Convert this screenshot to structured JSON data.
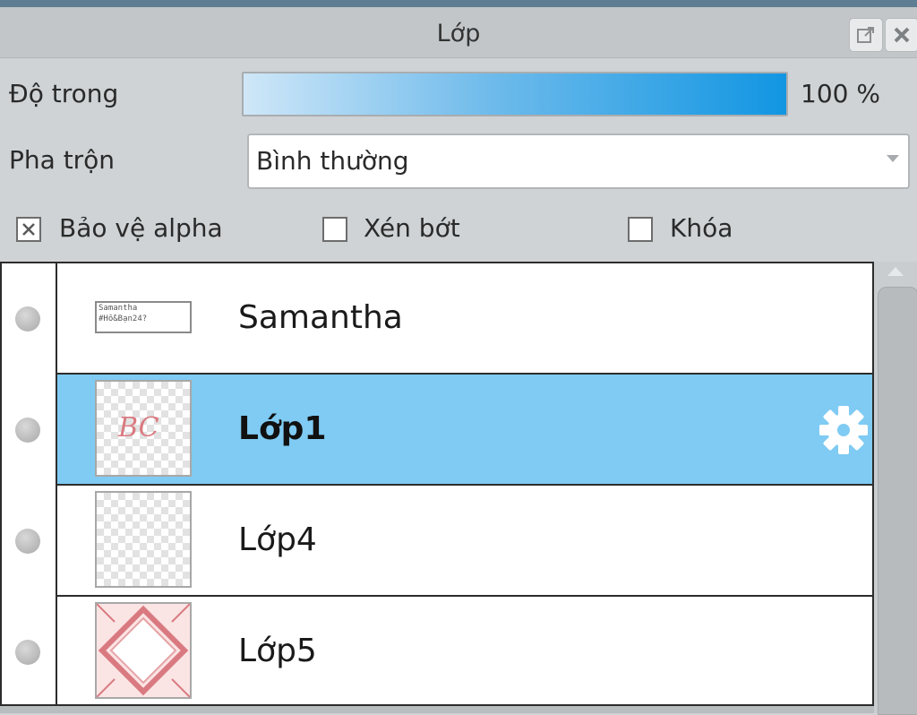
{
  "panel": {
    "title": "Lớp"
  },
  "opacity": {
    "label": "Độ trong",
    "value": "100 %",
    "fraction": 1.0
  },
  "blend": {
    "label": "Pha trộn",
    "value": "Bình thường"
  },
  "checkboxes": [
    {
      "label": "Bảo vệ alpha",
      "checked": true
    },
    {
      "label": "Xén bớt",
      "checked": false
    },
    {
      "label": "Khóa",
      "checked": false
    }
  ],
  "layers": [
    {
      "name": "Samantha",
      "thumb_line1": "Samantha",
      "thumb_line2": "#Hồ&Bạn24?",
      "selected": false
    },
    {
      "name": "Lớp1",
      "thumb_text": "BC",
      "selected": true
    },
    {
      "name": "Lớp4",
      "selected": false
    },
    {
      "name": "Lớp5",
      "selected": false
    }
  ],
  "colors": {
    "accent": "#1296e2",
    "selected_row": "#7fcbf3",
    "thumb_pink": "#d97a80"
  },
  "icons": [
    "popout-icon",
    "close-icon",
    "gear-icon",
    "visibility-icon",
    "dropdown-arrow-icon"
  ]
}
